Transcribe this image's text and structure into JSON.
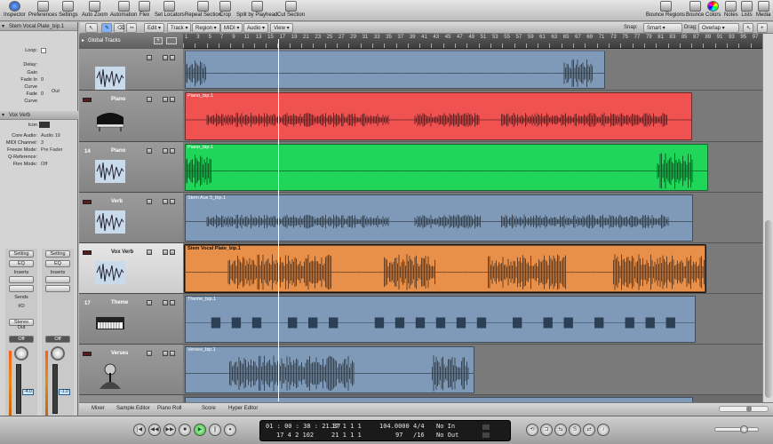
{
  "toolbar": {
    "left": [
      {
        "label": "Inspector",
        "icon": "info-icon"
      },
      {
        "label": "Preferences",
        "icon": "preferences-icon"
      },
      {
        "label": "Settings",
        "icon": "settings-icon"
      },
      {
        "label": "Auto Zoom",
        "icon": "auto-zoom-icon"
      },
      {
        "label": "Automation",
        "icon": "automation-icon"
      },
      {
        "label": "Flex",
        "icon": "flex-icon"
      },
      {
        "label": "Set Locators",
        "icon": "set-locators-icon"
      },
      {
        "label": "Repeat Section",
        "icon": "repeat-section-icon"
      },
      {
        "label": "Crop",
        "icon": "crop-icon"
      },
      {
        "label": "Split by Playhead",
        "icon": "split-icon"
      },
      {
        "label": "Cut Section",
        "icon": "cut-section-icon"
      }
    ],
    "right": [
      {
        "label": "Bounce Regions",
        "icon": "bounce-regions-icon"
      },
      {
        "label": "Bounce",
        "icon": "bounce-icon"
      },
      {
        "label": "Colors",
        "icon": "colors-icon"
      },
      {
        "label": "Notes",
        "icon": "notes-icon"
      },
      {
        "label": "Lists",
        "icon": "lists-icon"
      },
      {
        "label": "Media",
        "icon": "media-icon"
      }
    ]
  },
  "menubar": {
    "menus": [
      "Edit",
      "Track",
      "Region",
      "MIDI",
      "Audio",
      "View"
    ],
    "snap_label": "Snap:",
    "snap_value": "Smart",
    "drag_label": "Drag:",
    "drag_value": "Overlap"
  },
  "inspector": {
    "region_header": "Stem Vocal Plate_bip.1",
    "region_params": [
      {
        "label": "Loop:",
        "value": ""
      },
      {
        "label": "Delay:",
        "value": ""
      },
      {
        "label": "Gain",
        "value": ""
      },
      {
        "label": "Fade In",
        "value": "0"
      },
      {
        "label": "Curve",
        "value": ""
      },
      {
        "label": "Fade",
        "value": "0"
      },
      {
        "label": "Curve",
        "value": ""
      }
    ],
    "fade_out_label": "Out",
    "track_header": "Vox Verb",
    "icon_label": "Icon",
    "track_params": [
      {
        "label": "Core Audio:",
        "value": "Audio 19"
      },
      {
        "label": "MIDI Channel:",
        "value": "3"
      },
      {
        "label": "Freeze Mode:",
        "value": "Pre Fader"
      },
      {
        "label": "Q-Reference:",
        "value": ""
      },
      {
        "label": "Flex Mode:",
        "value": "Off"
      }
    ],
    "strips": [
      {
        "setting": "Setting",
        "eq": "EQ",
        "inserts": "Inserts",
        "sends": "Sends",
        "io": "I/O",
        "out": "Stereo Out",
        "off": "Off",
        "volume": "-4.0",
        "name": "Vox Verb",
        "name_color": "#4d87c7"
      },
      {
        "setting": "Setting",
        "eq": "EQ",
        "inserts": "Inserts",
        "sends": "",
        "io": "",
        "out": "",
        "off": "Off",
        "volume": "-1.0",
        "name": "Output",
        "name_color": "#79b84a"
      }
    ]
  },
  "tracks": {
    "global_label": "Global Tracks",
    "items": [
      {
        "num": "",
        "name": "",
        "thumb": "audio",
        "height": 47,
        "selected": false
      },
      {
        "num": "",
        "name": "Piano",
        "thumb": "piano",
        "height": 58,
        "selected": false
      },
      {
        "num": "14",
        "name": "Piano",
        "thumb": "audio",
        "height": 57,
        "selected": false
      },
      {
        "num": "",
        "name": "Verb",
        "thumb": "audio",
        "height": 57,
        "selected": false
      },
      {
        "num": "",
        "name": "Vox Verb",
        "thumb": "audio",
        "height": 57,
        "selected": true
      },
      {
        "num": "17",
        "name": "Theme",
        "thumb": "keyboard",
        "height": 57,
        "selected": false
      },
      {
        "num": "",
        "name": "Verses",
        "thumb": "singer",
        "height": 57,
        "selected": false
      }
    ]
  },
  "ruler": {
    "ticks": [
      "1",
      "3",
      "5",
      "7",
      "9",
      "11",
      "13",
      "15",
      "17",
      "19",
      "21",
      "23",
      "25",
      "27",
      "29",
      "31",
      "33",
      "35",
      "37",
      "39",
      "41",
      "43",
      "45",
      "47",
      "49",
      "51",
      "53",
      "55",
      "57",
      "59",
      "61",
      "63",
      "65",
      "67",
      "69",
      "71",
      "73",
      "75",
      "77",
      "79",
      "81",
      "83",
      "85",
      "87",
      "89",
      "91",
      "93",
      "95",
      "97"
    ]
  },
  "regions": [
    {
      "name": "",
      "lane": 0,
      "start": 0.0,
      "end": 0.725,
      "color": "#7e9ab8",
      "wave": "sparse"
    },
    {
      "name": "Piano_bip.1",
      "lane": 1,
      "start": 0.0,
      "end": 0.876,
      "color": "#f05252",
      "wave": "dense"
    },
    {
      "name": "Piano_bip.1",
      "lane": 2,
      "start": 0.0,
      "end": 0.903,
      "color": "#20d65a",
      "wave": "sparse"
    },
    {
      "name": "Stem Aux 5_bip.1",
      "lane": 3,
      "start": 0.0,
      "end": 0.878,
      "color": "#7e9ab8",
      "wave": "dense"
    },
    {
      "name": "Stem Vocal Plate_bip.1",
      "lane": 4,
      "start": 0.0,
      "end": 0.899,
      "color": "#e88f4a",
      "wave": "vocal"
    },
    {
      "name": "Theme_bip.1",
      "lane": 5,
      "start": 0.0,
      "end": 0.882,
      "color": "#7e9ab8",
      "wave": "blocks"
    },
    {
      "name": "Verses_bip.1",
      "lane": 6,
      "start": 0.0,
      "end": 0.5,
      "color": "#7e9ab8",
      "wave": "vocal-short"
    }
  ],
  "tabs": [
    "Mixer",
    "Sample Editor",
    "Piano Roll",
    "Score",
    "Hyper Editor"
  ],
  "transport": {
    "buttons": [
      "rewind-to-start",
      "rewind",
      "fast-forward",
      "stop",
      "play",
      "pause",
      "record"
    ],
    "lcd": {
      "time": "01 : 00 : 38 : 21.37",
      "bars": "17   4   2  102",
      "pos_top": "17   1   1   1",
      "pos_bottom": "21   1   1   1",
      "tempo": "104.0000",
      "division": "97",
      "sig_top": "4/4",
      "sig_bottom": "/16",
      "in": "No In",
      "out": "No Out"
    }
  },
  "colors": {
    "playhead": "#ffffff"
  }
}
